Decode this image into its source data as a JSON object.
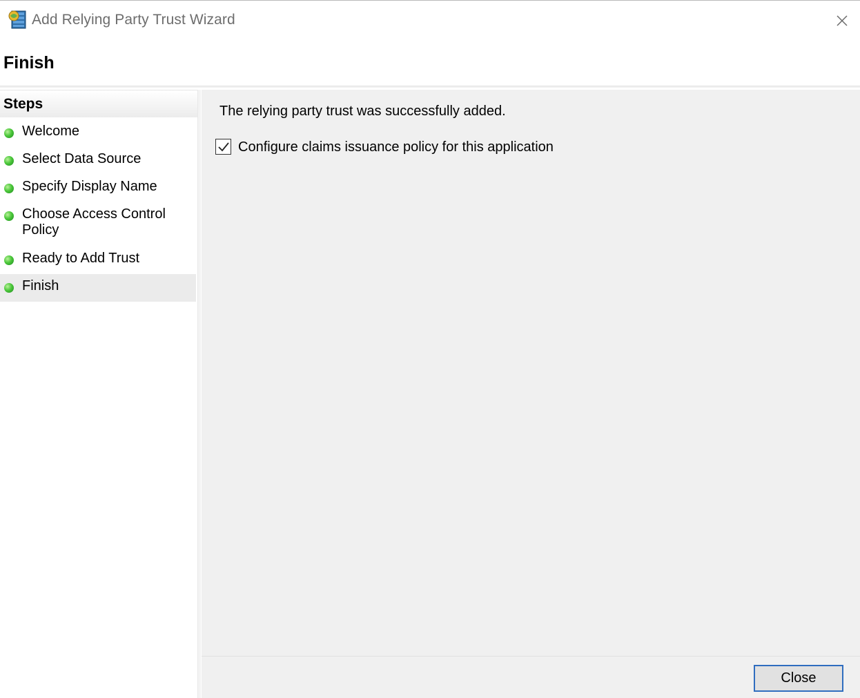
{
  "window": {
    "title": "Add Relying Party Trust Wizard",
    "app_icon": "adfs-server-icon",
    "close_icon": "close-icon"
  },
  "page": {
    "title": "Finish"
  },
  "steps": {
    "header": "Steps",
    "items": [
      {
        "label": "Welcome",
        "status": "complete"
      },
      {
        "label": "Select Data Source",
        "status": "complete"
      },
      {
        "label": "Specify Display Name",
        "status": "complete"
      },
      {
        "label": "Choose Access Control Policy",
        "status": "complete"
      },
      {
        "label": "Ready to Add Trust",
        "status": "complete"
      },
      {
        "label": "Finish",
        "status": "complete",
        "active": true
      }
    ]
  },
  "content": {
    "message": "The relying party trust was successfully added.",
    "configure_checkbox": {
      "label": "Configure claims issuance policy for this application",
      "checked": true
    }
  },
  "footer": {
    "close_label": "Close"
  },
  "colors": {
    "step_complete": "#3cb43c",
    "button_focus_border": "#2f6dbf",
    "content_bg": "#f0f0f0"
  }
}
